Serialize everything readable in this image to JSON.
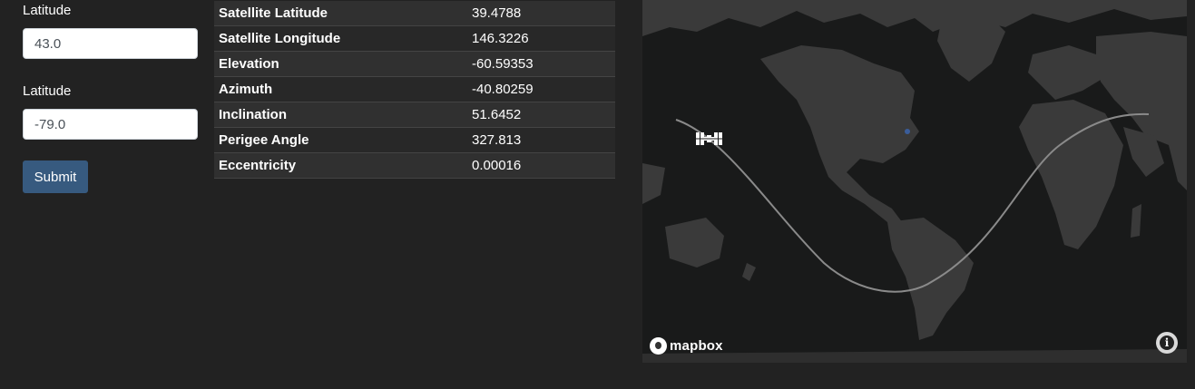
{
  "form": {
    "fields": [
      {
        "label": "Latitude",
        "value": "43.0"
      },
      {
        "label": "Latitude",
        "value": "-79.0"
      }
    ],
    "submit_label": "Submit"
  },
  "satellite_info": [
    {
      "key": "Satellite Latitude",
      "value": "39.4788"
    },
    {
      "key": "Satellite Longitude",
      "value": "146.3226"
    },
    {
      "key": "Elevation",
      "value": "-60.59353"
    },
    {
      "key": "Azimuth",
      "value": "-40.80259"
    },
    {
      "key": "Inclination",
      "value": "51.6452"
    },
    {
      "key": "Perigee Angle",
      "value": "327.813"
    },
    {
      "key": "Eccentricity",
      "value": "0.00016"
    }
  ],
  "map": {
    "attribution_text": "mapbox",
    "info_icon": "info-icon",
    "satellite_icon": "satellite-icon",
    "colors": {
      "water": "#191a1a",
      "land": "#3a3a3a",
      "track": "#8a8a8a",
      "observer": "#3a5d9a"
    }
  },
  "colors": {
    "background": "#222222",
    "button": "#375a7f"
  }
}
